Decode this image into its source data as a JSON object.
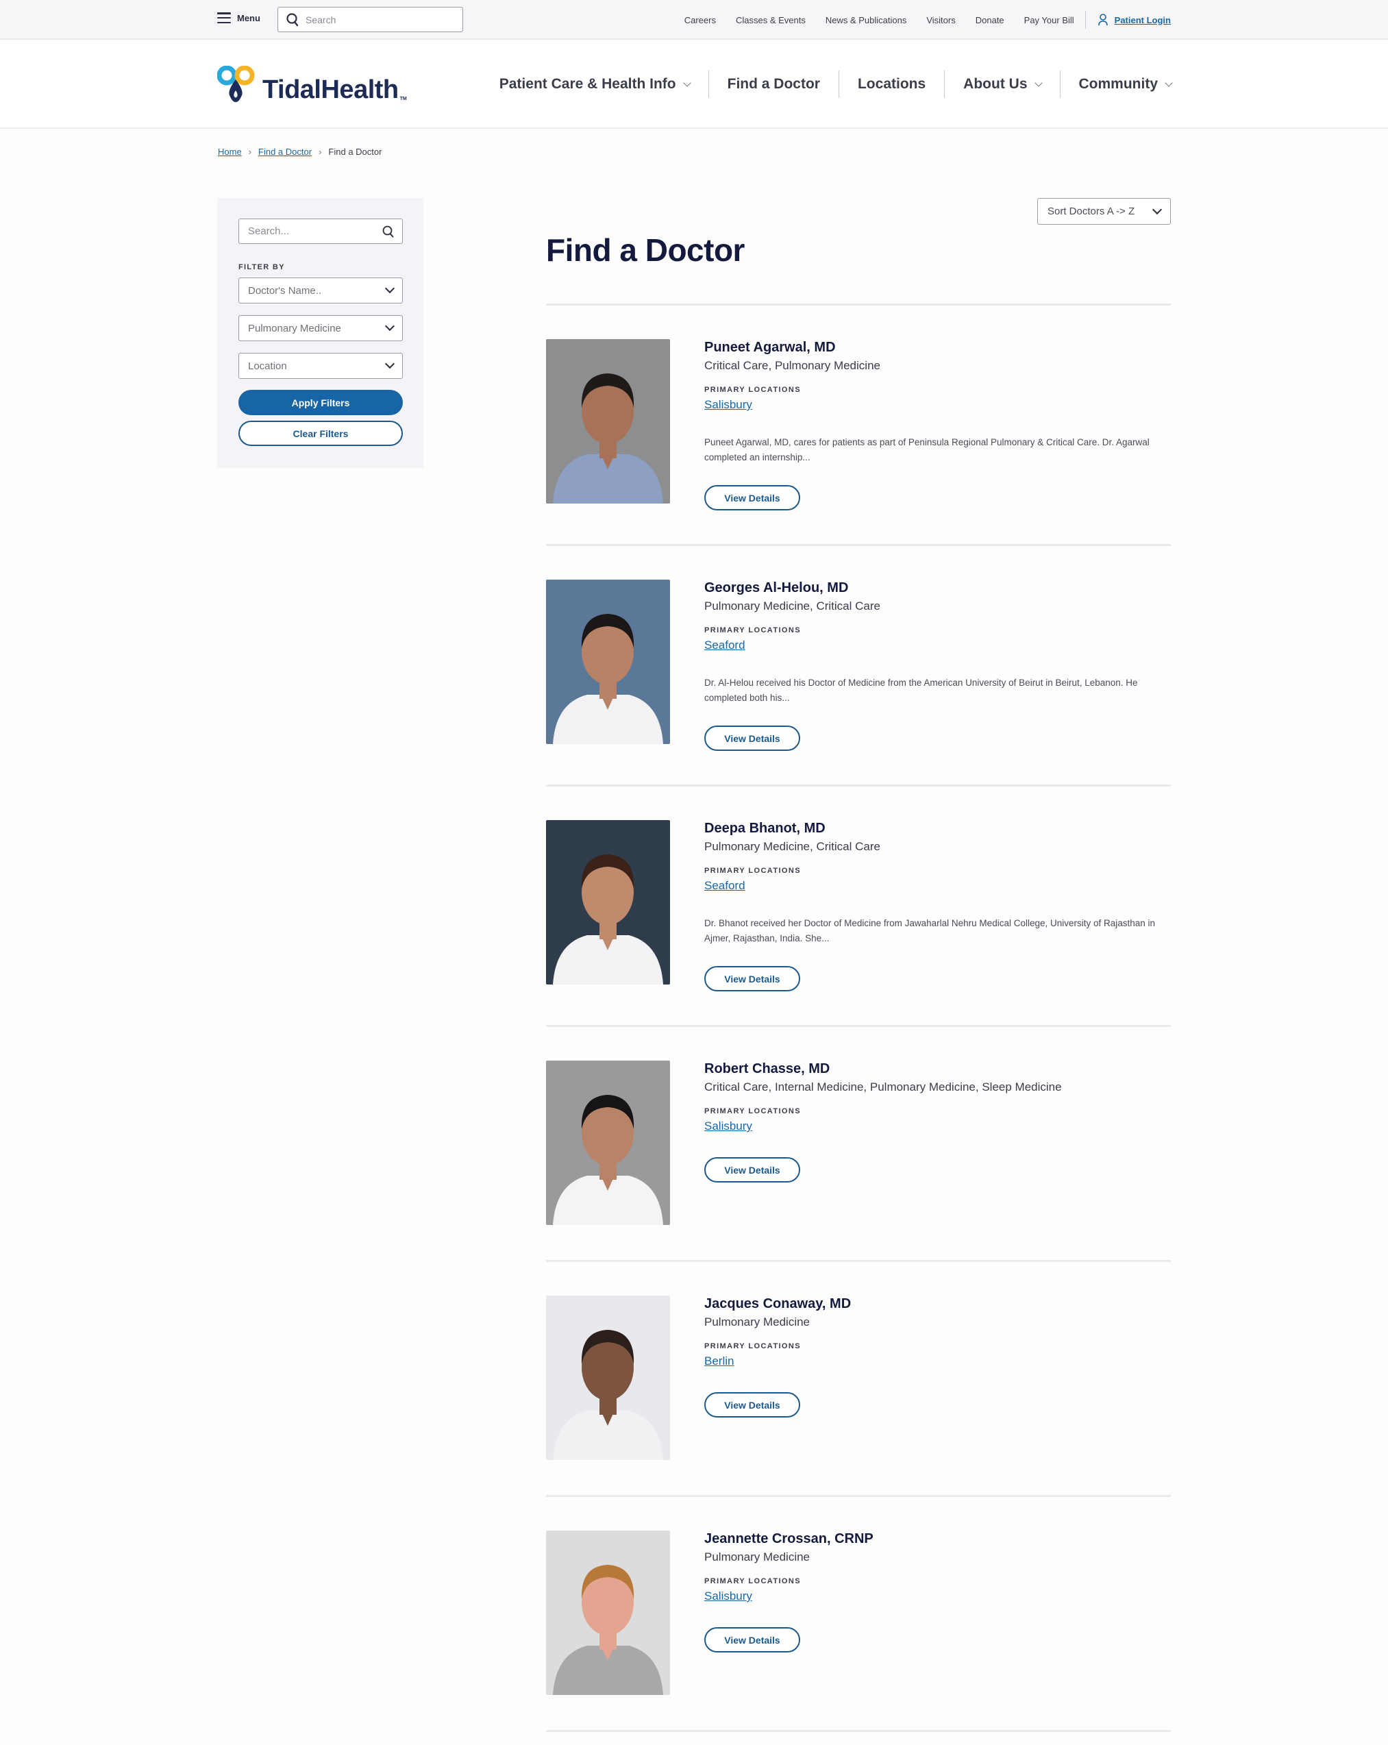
{
  "utility_bar": {
    "menu_label": "Menu",
    "search_placeholder": "Search",
    "links": [
      "Careers",
      "Classes & Events",
      "News & Publications",
      "Visitors",
      "Donate",
      "Pay Your Bill"
    ],
    "login_label": "Patient Login"
  },
  "header": {
    "logo_text": "TidalHealth",
    "logo_tm": "TM",
    "nav": [
      {
        "label": "Patient Care & Health Info",
        "has_dropdown": true
      },
      {
        "label": "Find a Doctor",
        "has_dropdown": false
      },
      {
        "label": "Locations",
        "has_dropdown": false
      },
      {
        "label": "About Us",
        "has_dropdown": true
      },
      {
        "label": "Community",
        "has_dropdown": true
      }
    ]
  },
  "breadcrumb": [
    {
      "label": "Home",
      "link": true
    },
    {
      "label": "Find a Doctor",
      "link": true
    },
    {
      "label": "Find a Doctor",
      "link": false
    }
  ],
  "sidebar": {
    "search_placeholder": "Search...",
    "filter_label": "FILTER BY",
    "filters": [
      {
        "value": "Doctor's Name.."
      },
      {
        "value": "Pulmonary Medicine"
      },
      {
        "value": "Location"
      }
    ],
    "apply_label": "Apply Filters",
    "clear_label": "Clear Filters"
  },
  "main": {
    "sort_label": "Sort Doctors A -> Z",
    "title": "Find a Doctor",
    "locations_label": "PRIMARY LOCATIONS",
    "view_details_label": "View Details",
    "doctors": [
      {
        "name": "Puneet Agarwal, MD",
        "specialties": "Critical Care, Pulmonary Medicine",
        "location": "Salisbury",
        "bio": "Puneet Agarwal, MD, cares for patients as part of Peninsula Regional Pulmonary & Critical Care. Dr. Agarwal completed an internship...",
        "photo": {
          "bg": "#8d8e90",
          "skin": "#a87259",
          "hair": "#1f1a18",
          "shirt": "#8da0c4"
        }
      },
      {
        "name": "Georges Al-Helou, MD",
        "specialties": "Pulmonary Medicine, Critical Care",
        "location": "Seaford",
        "bio": "Dr. Al-Helou received his Doctor of Medicine from the American University of Beirut in Beirut, Lebanon. He completed both his...",
        "photo": {
          "bg": "#5b7898",
          "skin": "#b88266",
          "hair": "#1b1716",
          "shirt": "#f2f2f4"
        }
      },
      {
        "name": "Deepa Bhanot, MD",
        "specialties": "Pulmonary Medicine, Critical Care",
        "location": "Seaford",
        "bio": "Dr. Bhanot received her Doctor of Medicine from Jawaharlal Nehru Medical College, University of Rajasthan in Ajmer, Rajasthan, India. She...",
        "photo": {
          "bg": "#2f3c4c",
          "skin": "#c08a6c",
          "hair": "#3a2218",
          "shirt": "#f3f3f5"
        }
      },
      {
        "name": "Robert Chasse, MD",
        "specialties": "Critical Care, Internal Medicine, Pulmonary Medicine, Sleep Medicine",
        "location": "Salisbury",
        "bio": "",
        "photo": {
          "bg": "#9a9a9c",
          "skin": "#b88367",
          "hair": "#161414",
          "shirt": "#f4f4f6"
        }
      },
      {
        "name": "Jacques Conaway, MD",
        "specialties": "Pulmonary Medicine",
        "location": "Berlin",
        "bio": "",
        "photo": {
          "bg": "#e8e9ec",
          "skin": "#7c5440",
          "hair": "#2a1f1a",
          "shirt": "#f1f1f3"
        }
      },
      {
        "name": "Jeannette Crossan, CRNP",
        "specialties": "Pulmonary Medicine",
        "location": "Salisbury",
        "bio": "",
        "photo": {
          "bg": "#dcdcdc",
          "skin": "#e3a58f",
          "hair": "#b8783a",
          "shirt": "#a7a8aa"
        }
      }
    ]
  },
  "colors": {
    "brand_navy": "#1d2b57",
    "accent_blue": "#1764a6",
    "link_blue": "#1768a7",
    "logo_cyan": "#2aa8dc",
    "logo_yellow": "#f5b428"
  }
}
